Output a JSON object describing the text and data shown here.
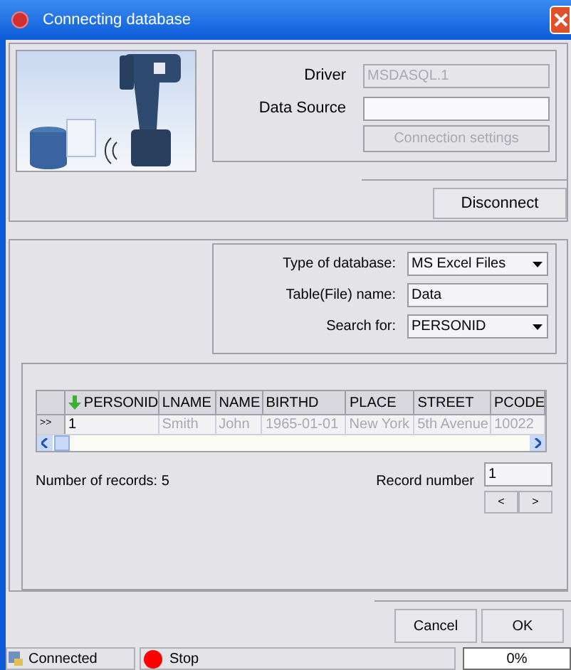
{
  "window": {
    "title": "Connecting database"
  },
  "connection": {
    "fields": [
      {
        "label": "Driver",
        "value": "MSDASQL.1",
        "disabled": true
      },
      {
        "label": "Data Source",
        "disabled": false
      }
    ],
    "settings_button": {
      "label": "Connection settings",
      "disabled": true
    },
    "disconnect_button": "Disconnect"
  },
  "database": {
    "fields": [
      {
        "kind": "dropdown",
        "label": "Type of database:",
        "value": "MS Excel Files"
      },
      {
        "kind": "text",
        "label": "Table(File) name:",
        "value": "Data"
      },
      {
        "kind": "dropdown",
        "label": "Search for:",
        "value": "PERSONID"
      }
    ]
  },
  "table": {
    "columns": [
      {
        "label": "PERSONID",
        "sorted": true
      },
      {
        "label": "LNAME",
        "sorted": false
      },
      {
        "label": "NAME",
        "sorted": false
      },
      {
        "label": "BIRTHD",
        "sorted": false
      },
      {
        "label": "PLACE",
        "sorted": false
      },
      {
        "label": "STREET",
        "sorted": false
      },
      {
        "label": "PCODE",
        "sorted": false
      }
    ],
    "rows": [
      {
        "indicator": ">>",
        "cells": [
          {
            "text": "1",
            "disabled": false
          },
          {
            "text": "Smith",
            "disabled": true
          },
          {
            "text": "John",
            "disabled": true
          },
          {
            "text": "1965-01-01",
            "disabled": true
          },
          {
            "text": "New York",
            "disabled": true
          },
          {
            "text": "5th Avenue",
            "disabled": true
          },
          {
            "text": "10022",
            "disabled": true
          }
        ]
      }
    ]
  },
  "records": {
    "count_text": "Number of records: 5",
    "record_label": "Record number",
    "record_value": "1",
    "prev": "<",
    "next": ">"
  },
  "buttons": [
    "Cancel",
    "OK"
  ],
  "status_bar": {
    "connection": "Connected",
    "stop": "Stop",
    "progress": {
      "text": "0%",
      "level": 0
    }
  }
}
